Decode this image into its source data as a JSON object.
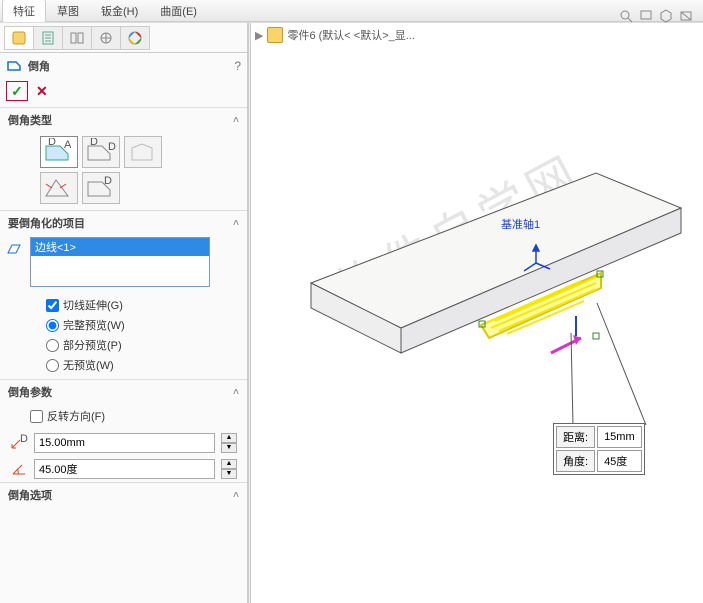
{
  "ribbon": {
    "tabs": [
      "特征",
      "草图",
      "钣金(H)",
      "曲面(E)"
    ],
    "active": 0
  },
  "feature": {
    "title": "倒角",
    "help": "?"
  },
  "sections": {
    "type_title": "倒角类型",
    "items_title": "要倒角化的项目",
    "params_title": "倒角参数",
    "options_title": "倒角选项"
  },
  "items": {
    "selected": "边线<1>"
  },
  "opts": {
    "tangent": "切线延伸(G)",
    "tangent_checked": true,
    "preview_full": "完整预览(W)",
    "preview_partial": "部分预览(P)",
    "preview_none": "无预览(W)",
    "preview_value": "full"
  },
  "params": {
    "reverse": "反转方向(F)",
    "reverse_checked": false,
    "distance": "15.00mm",
    "angle": "45.00度"
  },
  "viewport": {
    "breadcrumb_arrow": "▶",
    "part_name": "零件6  (默认< <默认>_显...",
    "axis_label": "基准轴1"
  },
  "annot": {
    "dist_label": "距离:",
    "dist_val": "15mm",
    "ang_label": "角度:",
    "ang_val": "45度"
  },
  "watermark": "软件自学网",
  "chart_data": {
    "type": "table",
    "title": "倒角参数",
    "rows": [
      {
        "label": "距离",
        "value": 15,
        "unit": "mm"
      },
      {
        "label": "角度",
        "value": 45,
        "unit": "度"
      }
    ]
  }
}
